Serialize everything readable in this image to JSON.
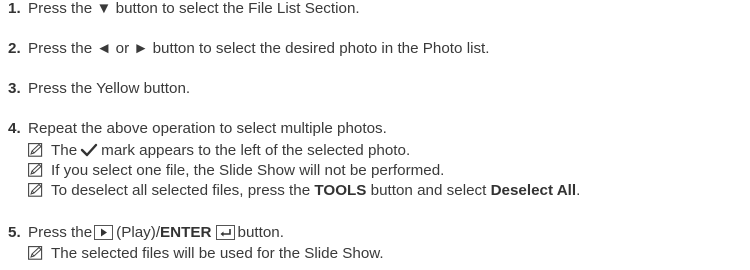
{
  "steps": [
    {
      "num": "1.",
      "text": "Press the ▼ button to select the File List Section."
    },
    {
      "num": "2.",
      "text": "Press the ◄ or ► button to select the desired photo in the Photo list."
    },
    {
      "num": "3.",
      "text": "Press the Yellow button."
    },
    {
      "num": "4.",
      "text": "Repeat the above operation to select multiple photos.",
      "notes": {
        "n1_before": "The",
        "n1_after": "mark appears to the left of the selected photo.",
        "n2": "If you select one file, the Slide Show will not be performed.",
        "n3_before": "To deselect all selected files, press the ",
        "n3_tools": "TOOLS",
        "n3_middle": " button and select ",
        "n3_deselect": "Deselect All",
        "n3_end": "."
      }
    },
    {
      "num": "5.",
      "text_before": "Press the",
      "text_play": "(Play)/",
      "text_enter": "ENTER",
      "text_after": "button.",
      "note": "The selected files will be used for the Slide Show."
    }
  ],
  "icons": {
    "note": "note-pencil-icon",
    "check": "checkmark-icon",
    "play": "play-key-icon",
    "enter": "enter-key-icon"
  }
}
